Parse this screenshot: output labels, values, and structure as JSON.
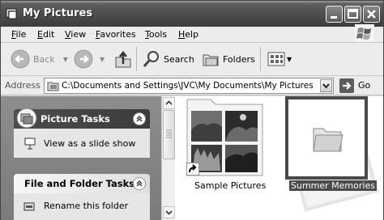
{
  "window": {
    "title": "My Pictures",
    "controls": [
      "minimize",
      "maximize",
      "close"
    ]
  },
  "menu": [
    {
      "label": "File"
    },
    {
      "label": "Edit"
    },
    {
      "label": "View"
    },
    {
      "label": "Favorites"
    },
    {
      "label": "Tools"
    },
    {
      "label": "Help"
    }
  ],
  "toolbar": {
    "back_label": "Back",
    "search_label": "Search",
    "folders_label": "Folders"
  },
  "address": {
    "label": "Address",
    "value": "C:\\Documents and Settings\\JVC\\My Documents\\My Pictures",
    "go_label": "Go"
  },
  "tasks": {
    "picture_tasks": {
      "title": "Picture Tasks",
      "items": [
        {
          "label": "View as a slide show"
        }
      ]
    },
    "file_folder_tasks": {
      "title": "File and Folder Tasks",
      "items": [
        {
          "label": "Rename this folder"
        }
      ]
    }
  },
  "items": [
    {
      "label": "Sample Pictures",
      "selected": false
    },
    {
      "label": "Summer Memories",
      "selected": true
    }
  ],
  "colors": {
    "selection": "#4b4b4b",
    "title_bar": "#4a4a4a",
    "task_pane": "#8a8a8a"
  }
}
